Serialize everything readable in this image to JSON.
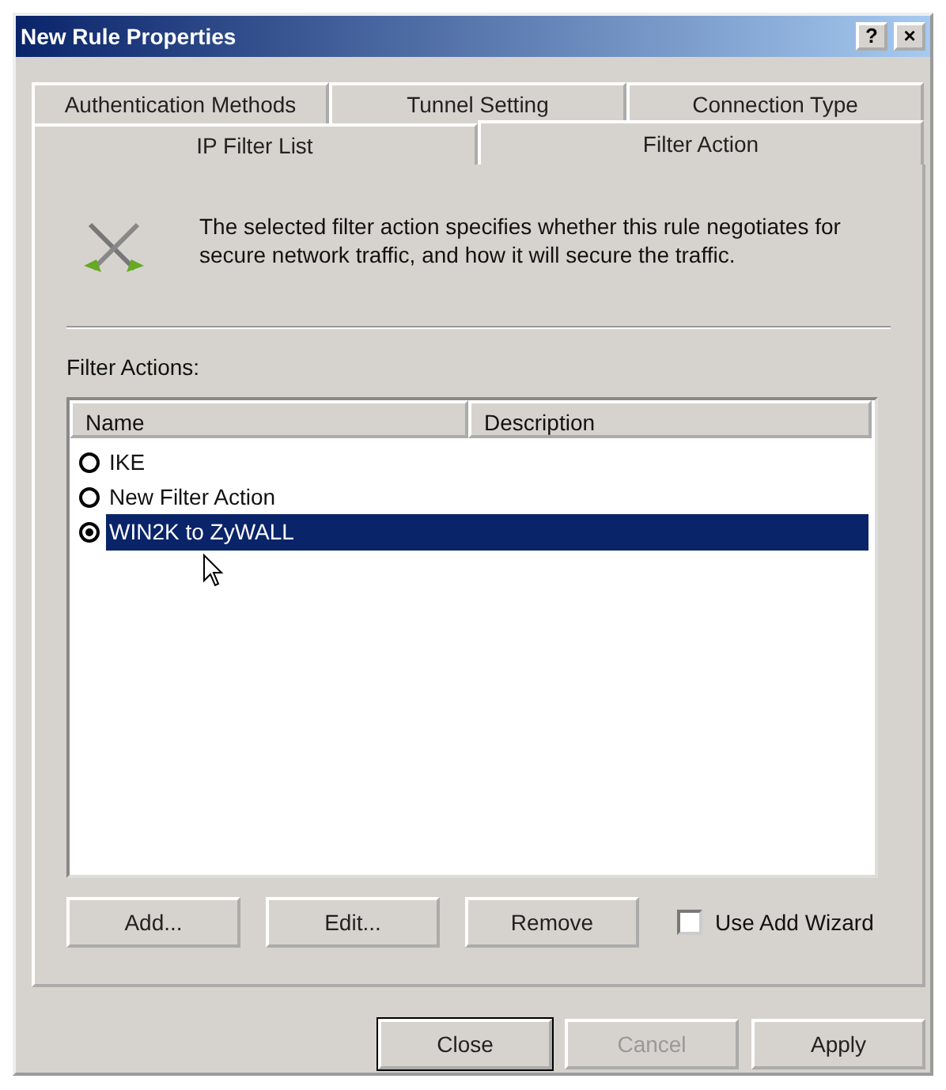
{
  "window": {
    "title": "New Rule Properties",
    "buttons": [
      "?",
      "×"
    ]
  },
  "tab_rows": [
    [
      {
        "label": "Authentication Methods",
        "selected": false
      },
      {
        "label": "Tunnel Setting",
        "selected": false
      },
      {
        "label": "Connection Type",
        "selected": false
      }
    ],
    [
      {
        "label": "IP Filter List",
        "selected": false
      },
      {
        "label": "Filter Action",
        "selected": true
      }
    ]
  ],
  "description": "The selected filter action specifies whether this rule negotiates for secure network traffic, and how it will secure the traffic.",
  "list_label": "Filter Actions:",
  "table": {
    "columns": [
      "Name",
      "Description"
    ],
    "rows": [
      {
        "name": "IKE",
        "selected": false
      },
      {
        "name": "New Filter Action",
        "selected": false
      },
      {
        "name": "WIN2K to ZyWALL",
        "selected": true
      }
    ]
  },
  "list_buttons": [
    "Add...",
    "Edit...",
    "Remove"
  ],
  "wizard": {
    "label": "Use Add Wizard",
    "checked": false
  },
  "dialog_buttons": [
    {
      "label": "Close",
      "disabled": false,
      "default": true
    },
    {
      "label": "Cancel",
      "disabled": true,
      "default": false
    },
    {
      "label": "Apply",
      "disabled": false,
      "default": false
    }
  ]
}
